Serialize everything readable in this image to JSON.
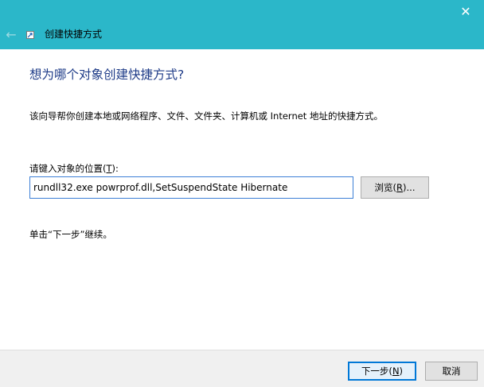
{
  "window": {
    "close_glyph": "✕"
  },
  "header": {
    "back_glyph": "←",
    "title": "创建快捷方式"
  },
  "main": {
    "heading": "想为哪个对象创建快捷方式?",
    "description": "该向导帮你创建本地或网络程序、文件、文件夹、计算机或 Internet 地址的快捷方式。",
    "location_label_prefix": "请键入对象的位置(",
    "location_label_accel": "T",
    "location_label_suffix": "):",
    "location_value": "rundll32.exe powrprof.dll,SetSuspendState Hibernate",
    "browse_prefix": "浏览(",
    "browse_accel": "R",
    "browse_suffix": ")...",
    "continue_hint": "单击“下一步”继续。"
  },
  "footer": {
    "next_prefix": "下一步(",
    "next_accel": "N",
    "next_suffix": ")",
    "cancel_label": "取消"
  },
  "colors": {
    "titlebar": "#2bb7c9",
    "heading": "#1f3c88",
    "input_border": "#3c7fd6",
    "default_button_border": "#0078d7"
  },
  "icons": {
    "app": "shortcut-icon",
    "back": "back-arrow-icon",
    "close": "close-icon"
  }
}
